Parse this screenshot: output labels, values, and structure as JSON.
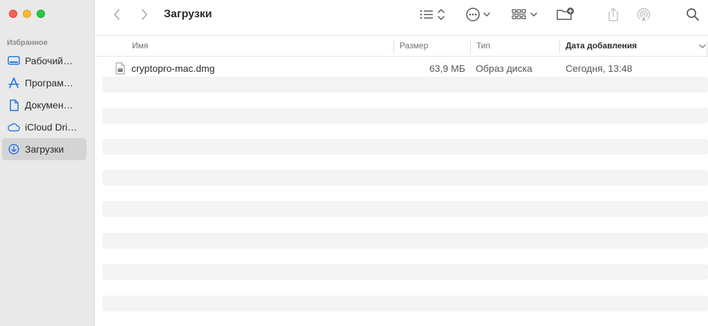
{
  "window": {
    "title": "Загрузки"
  },
  "sidebar": {
    "section_title": "Избранное",
    "items": [
      {
        "label": "Рабочий стол",
        "display": "Рабочий…",
        "icon": "desktop-icon"
      },
      {
        "label": "Программы",
        "display": "Програм…",
        "icon": "applications-icon"
      },
      {
        "label": "Документы",
        "display": "Докумен…",
        "icon": "document-icon"
      },
      {
        "label": "iCloud Drive",
        "display": "iCloud Dri…",
        "icon": "icloud-icon"
      },
      {
        "label": "Загрузки",
        "display": "Загрузки",
        "icon": "downloads-icon",
        "active": true
      }
    ]
  },
  "toolbar": {
    "back": "back-icon",
    "forward": "forward-icon",
    "view": "list-view-icon",
    "actions": "more-icon",
    "group": "group-icon",
    "new_folder": "new-folder-icon",
    "share": "share-icon",
    "airdrop": "airdrop-icon",
    "search": "search-icon"
  },
  "columns": {
    "name": "Имя",
    "size": "Размер",
    "kind": "Тип",
    "date_added": "Дата добавления"
  },
  "files": [
    {
      "name": "cryptopro-mac.dmg",
      "size": "63,9 МБ",
      "kind": "Образ диска",
      "date_added": "Сегодня, 13:48"
    }
  ],
  "colors": {
    "accent": "#1a73e8",
    "sidebar_bg": "#e9e9e9",
    "stripe": "#f4f4f5"
  }
}
